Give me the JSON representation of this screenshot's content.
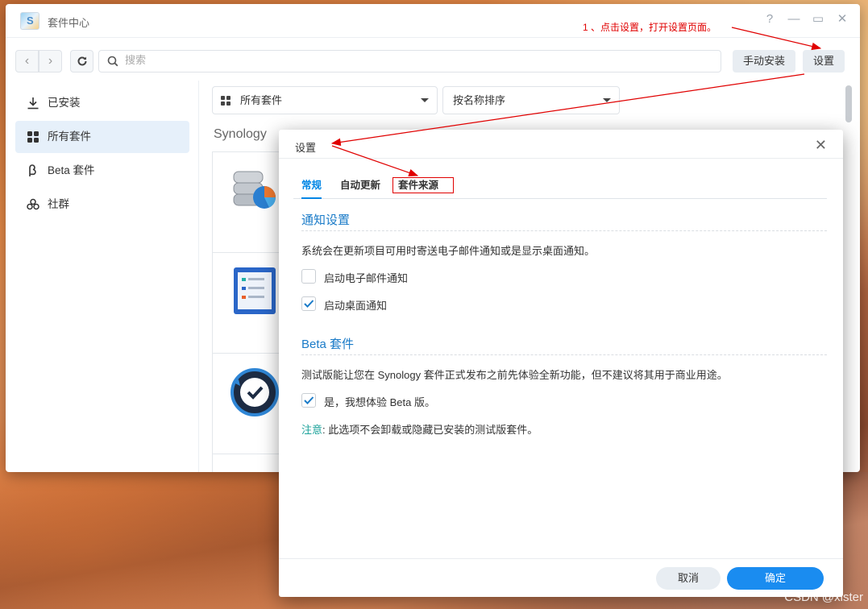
{
  "window": {
    "title": "套件中心",
    "controls": {
      "help": "?",
      "minimize": "—",
      "maximize": "▭",
      "close": "✕"
    }
  },
  "toolbar": {
    "back": "‹",
    "forward": "›",
    "search_placeholder": "搜索",
    "manual_install_label": "手动安装",
    "settings_label": "设置"
  },
  "sidebar": {
    "items": [
      {
        "label": "已安装",
        "icon": "download-icon"
      },
      {
        "label": "所有套件",
        "icon": "grid-icon",
        "active": true
      },
      {
        "label": "Beta 套件",
        "icon": "beta-icon"
      },
      {
        "label": "社群",
        "icon": "community-icon"
      }
    ]
  },
  "filters": {
    "category": "所有套件",
    "sort": "按名称排序"
  },
  "section_label": "Synology",
  "dialog": {
    "title": "设置",
    "tabs": [
      "常规",
      "自动更新",
      "套件来源"
    ],
    "notify": {
      "title": "通知设置",
      "desc": "系统会在更新项目可用时寄送电子邮件通知或是显示桌面通知。",
      "email_label": "启动电子邮件通知",
      "email_checked": false,
      "desktop_label": "启动桌面通知",
      "desktop_checked": true
    },
    "beta": {
      "title": "Beta 套件",
      "desc": "测试版能让您在 Synology 套件正式发布之前先体验全新功能，但不建议将其用于商业用途。",
      "opt_label": "是，我想体验 Beta 版。",
      "opt_checked": true,
      "note_key": "注意",
      "note_text": ": 此选项不会卸载或隐藏已安装的测试版套件。"
    },
    "cancel_label": "取消",
    "ok_label": "确定"
  },
  "annotation": {
    "text": "1 、点击设置，打开设置页面。",
    "color": "#e00000"
  },
  "watermark": "CSDN @xister"
}
